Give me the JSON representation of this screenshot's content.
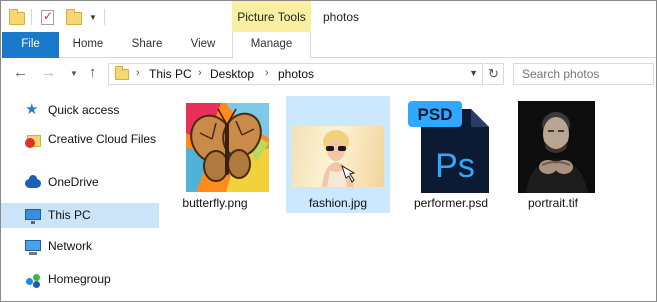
{
  "title_bar": {
    "contextual_tab_group": "Picture Tools",
    "window_title": "photos",
    "quick_access_icons": [
      "folder-icon",
      "properties-icon",
      "new-folder-icon",
      "customize-dropdown-icon"
    ]
  },
  "ribbon": {
    "tabs": [
      {
        "label": "File",
        "active": true
      },
      {
        "label": "Home"
      },
      {
        "label": "Share"
      },
      {
        "label": "View"
      },
      {
        "label": "Manage",
        "contextual": true
      }
    ],
    "colors": {
      "file_tab": "#1979ca",
      "contextual": "#f8f0a0"
    }
  },
  "navigation": {
    "back_icon": "arrow-left-icon",
    "forward_icon": "arrow-right-icon",
    "recent_icon": "chevron-down-icon",
    "up_icon": "arrow-up-icon",
    "breadcrumb": [
      "This PC",
      "Desktop",
      "photos"
    ],
    "search_placeholder": "Search photos"
  },
  "sidebar": {
    "items": [
      {
        "label": "Quick access",
        "icon": "star-icon"
      },
      {
        "label": "Creative Cloud Files",
        "icon": "creative-cloud-folder-icon"
      },
      {
        "label": "OneDrive",
        "icon": "cloud-icon"
      },
      {
        "label": "This PC",
        "icon": "computer-icon",
        "selected": true
      },
      {
        "label": "Network",
        "icon": "network-icon"
      },
      {
        "label": "Homegroup",
        "icon": "homegroup-icon"
      }
    ],
    "selection_color": "#cce4f7"
  },
  "files": [
    {
      "name": "butterfly.png",
      "thumb": "butterfly-thumbnail"
    },
    {
      "name": "fashion.jpg",
      "thumb": "fashion-thumbnail",
      "selected": true
    },
    {
      "name": "performer.psd",
      "thumb": "photoshop-file-icon",
      "badge": "PSD",
      "glyph": "Ps"
    },
    {
      "name": "portrait.tif",
      "thumb": "portrait-thumbnail"
    }
  ]
}
